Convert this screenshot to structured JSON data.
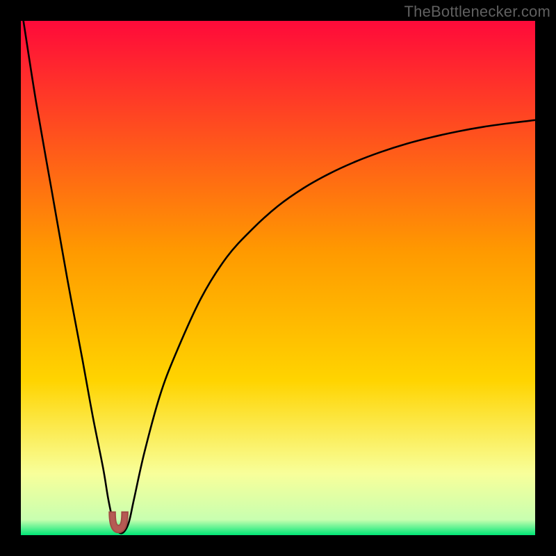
{
  "attribution": "TheBottlenecker.com",
  "colors": {
    "frame_bg": "#000000",
    "gradient_top": "#ff0a3a",
    "gradient_mid": "#ffd400",
    "gradient_pale": "#f8ff9a",
    "gradient_bottom": "#00e676",
    "curve": "#000000",
    "marker_fill": "#b55a54",
    "marker_stroke": "#a24b45"
  },
  "chart_data": {
    "type": "line",
    "title": "",
    "xlabel": "",
    "ylabel": "",
    "xlim": [
      0,
      100
    ],
    "ylim": [
      0,
      100
    ],
    "notes": "Bottleneck percentage vs. hardware balance. Minimum (optimal point) near x≈19. Curve falls sharply from top-left, reaches ~0 near x≈19, then rises asymptotically toward ~80 at the right edge. No axis ticks or labels are rendered.",
    "series": [
      {
        "name": "bottleneck-curve",
        "x": [
          0.5,
          3,
          6,
          9,
          12,
          14,
          16,
          17,
          18,
          19,
          20,
          21,
          22,
          24,
          27,
          30,
          35,
          40,
          45,
          50,
          55,
          60,
          65,
          70,
          75,
          80,
          85,
          90,
          95,
          100
        ],
        "y": [
          100,
          84,
          67,
          50,
          34,
          23,
          13,
          7,
          2.5,
          0.6,
          0.6,
          2.5,
          7,
          16,
          27,
          35,
          46,
          54,
          59.5,
          64,
          67.5,
          70.3,
          72.6,
          74.5,
          76.1,
          77.4,
          78.5,
          79.4,
          80.1,
          80.7
        ]
      }
    ],
    "marker": {
      "x_range": [
        17.2,
        20.8
      ],
      "y_min": 0.5
    }
  }
}
